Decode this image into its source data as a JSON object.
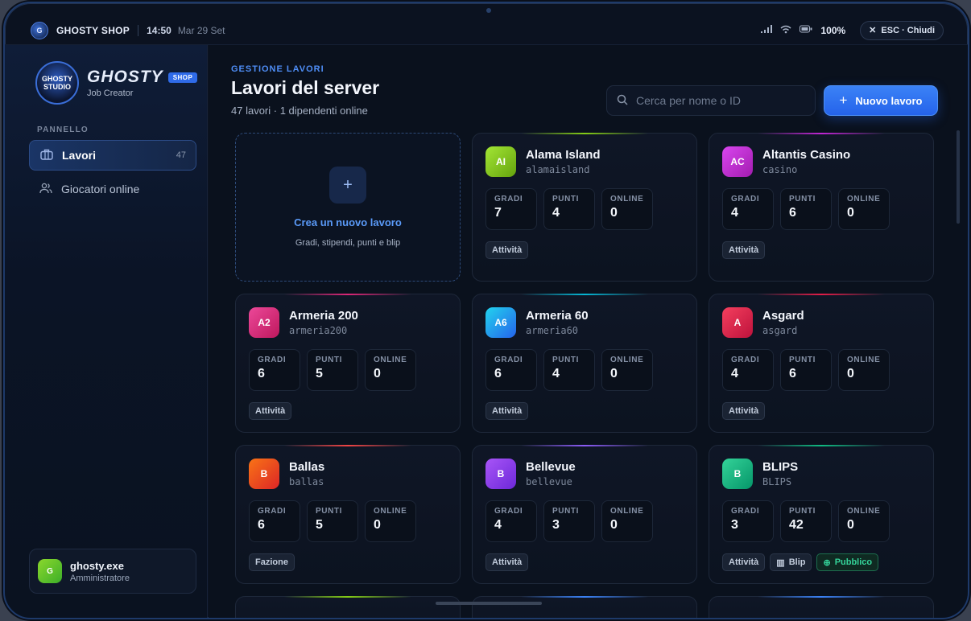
{
  "statusbar": {
    "brand": "GHOSTY SHOP",
    "time": "14:50",
    "date": "Mar 29 Set",
    "battery": "100%",
    "close_label": "ESC · Chiudi"
  },
  "sidebar": {
    "brand_name": "GHOSTY",
    "brand_badge": "SHOP",
    "brand_sub": "Job Creator",
    "logo_text": "Ghosty Studio Shop",
    "section_label": "PANNELLO",
    "items": [
      {
        "label": "Lavori",
        "count": "47",
        "icon": "briefcase-icon"
      },
      {
        "label": "Giocatori online",
        "count": "",
        "icon": "users-icon"
      }
    ],
    "user": {
      "avatar": "G",
      "name": "ghosty.exe",
      "role": "Amministratore"
    }
  },
  "main": {
    "eyebrow": "GESTIONE LAVORI",
    "title": "Lavori del server",
    "subtitle": "47 lavori · 1 dipendenti online",
    "search_placeholder": "Cerca per nome o ID",
    "new_button": "Nuovo lavoro",
    "create_card": {
      "title": "Crea un nuovo lavoro",
      "subtitle": "Gradi, stipendi, punti e blip"
    },
    "stat_labels": {
      "grades": "GRADI",
      "points": "PUNTI",
      "online": "ONLINE"
    },
    "jobs": [
      {
        "initials": "AI",
        "name": "Alama Island",
        "id": "alamaisland",
        "grades": "7",
        "points": "4",
        "online": "0",
        "tags": [
          "Attività"
        ],
        "color_from": "#a3e635",
        "color_to": "#65a30d",
        "glow": "#84cc16"
      },
      {
        "initials": "AC",
        "name": "Altantis Casino",
        "id": "casino",
        "grades": "4",
        "points": "6",
        "online": "0",
        "tags": [
          "Attività"
        ],
        "color_from": "#d946ef",
        "color_to": "#a21caf",
        "glow": "#c026d3"
      },
      {
        "initials": "A2",
        "name": "Armeria 200",
        "id": "armeria200",
        "grades": "6",
        "points": "5",
        "online": "0",
        "tags": [
          "Attività"
        ],
        "color_from": "#ec4899",
        "color_to": "#be185d",
        "glow": "#db2777"
      },
      {
        "initials": "A6",
        "name": "Armeria 60",
        "id": "armeria60",
        "grades": "6",
        "points": "4",
        "online": "0",
        "tags": [
          "Attività"
        ],
        "color_from": "#22d3ee",
        "color_to": "#2563eb",
        "glow": "#06b6d4"
      },
      {
        "initials": "A",
        "name": "Asgard",
        "id": "asgard",
        "grades": "4",
        "points": "6",
        "online": "0",
        "tags": [
          "Attività"
        ],
        "color_from": "#f43f5e",
        "color_to": "#be123c",
        "glow": "#e11d48"
      },
      {
        "initials": "B",
        "name": "Ballas",
        "id": "ballas",
        "grades": "6",
        "points": "5",
        "online": "0",
        "tags": [
          "Fazione"
        ],
        "color_from": "#f97316",
        "color_to": "#dc2626",
        "glow": "#ef4444"
      },
      {
        "initials": "B",
        "name": "Bellevue",
        "id": "bellevue",
        "grades": "4",
        "points": "3",
        "online": "0",
        "tags": [
          "Attività"
        ],
        "color_from": "#a855f7",
        "color_to": "#6d28d9",
        "glow": "#8b5cf6"
      },
      {
        "initials": "B",
        "name": "BLIPS",
        "id": "BLIPS",
        "grades": "3",
        "points": "42",
        "online": "0",
        "tags": [
          "Attività",
          "Blip",
          "Pubblico"
        ],
        "color_from": "#34d399",
        "color_to": "#059669",
        "glow": "#10b981"
      }
    ]
  }
}
